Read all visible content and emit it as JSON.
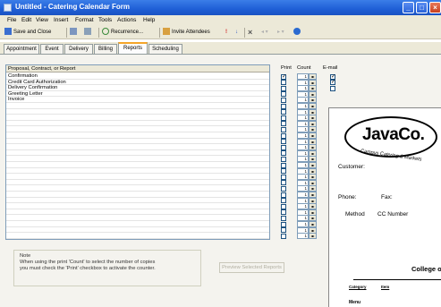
{
  "window": {
    "title": "Untitled - Catering Calendar Form"
  },
  "menu": [
    "File",
    "Edit",
    "View",
    "Insert",
    "Format",
    "Tools",
    "Actions",
    "Help"
  ],
  "toolbar": {
    "save_close": "Save and Close",
    "recurrence": "Recurrence...",
    "invite": "Invite Attendees"
  },
  "tabs": [
    "Appointment",
    "Event",
    "Delivery",
    "Billing",
    "Reports",
    "Scheduling"
  ],
  "active_tab": "Reports",
  "report_list": {
    "header": "Proposal, Contract, or Report",
    "items": [
      "Confirmation",
      "Credit Card Authorization",
      "Delivery Confirmation",
      "Greeting Letter",
      "Invoice"
    ]
  },
  "columns": {
    "print": "Print",
    "count": "Count",
    "email": "E-mail"
  },
  "print_checked": [
    true,
    false,
    false,
    false,
    false
  ],
  "email_checked": [
    true,
    true,
    false
  ],
  "counter_value": "1",
  "note": {
    "title": "Note",
    "line1": "When using the print 'Count' to select the number of copies",
    "line2": "you must check the 'Print' checkbox to activate the counter."
  },
  "preview_button": "Preview Selected Reports",
  "document": {
    "logo_name": "JavaCo.",
    "logo_tagline": "Campus Catering & Markets",
    "customer": "Customer:",
    "phone": "Phone:",
    "fax": "Fax:",
    "method": "Method",
    "cc_number": "CC Number",
    "college": "College o",
    "category": "Category",
    "item": "Item",
    "menu": "Menu"
  }
}
